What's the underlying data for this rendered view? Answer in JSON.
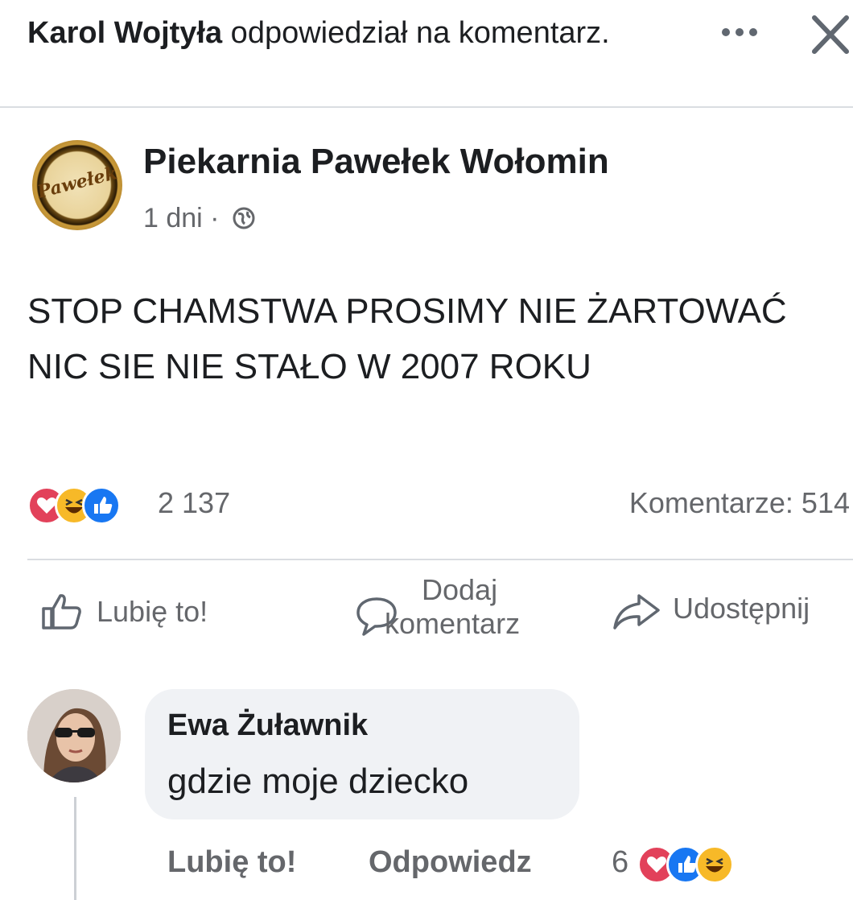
{
  "notification": {
    "actor": "Karol Wojtyła",
    "action": " odpowiedział na komentarz."
  },
  "post": {
    "page_name": "Piekarnia Pawełek Wołomin",
    "avatar_text": "Pawełek",
    "time": "1 dni ·",
    "text": "STOP CHAMSTWA PROSIMY NIE ŻARTOWAĆ NIC SIE NIE STAŁO W 2007 ROKU",
    "reaction_count": "2 137",
    "comment_count": "Komentarze: 514"
  },
  "actions": {
    "like": "Lubię to!",
    "comment_line1": "Dodaj",
    "comment_line2": "komentarz",
    "share": "Udostępnij"
  },
  "comment": {
    "author": "Ewa Żuławnik",
    "text": "gdzie moje dziecko",
    "like_label": "Lubię to!",
    "reply_label": "Odpowiedz",
    "reaction_count": "6"
  },
  "colors": {
    "love": "#e2415a",
    "haha": "#f7b928",
    "like": "#1877f2",
    "secondary_text": "#65676b"
  },
  "icons": [
    "more-icon",
    "close-icon",
    "globe-icon",
    "love-reaction-icon",
    "haha-reaction-icon",
    "like-reaction-icon",
    "thumbs-up-icon",
    "comment-bubble-icon",
    "share-arrow-icon"
  ]
}
